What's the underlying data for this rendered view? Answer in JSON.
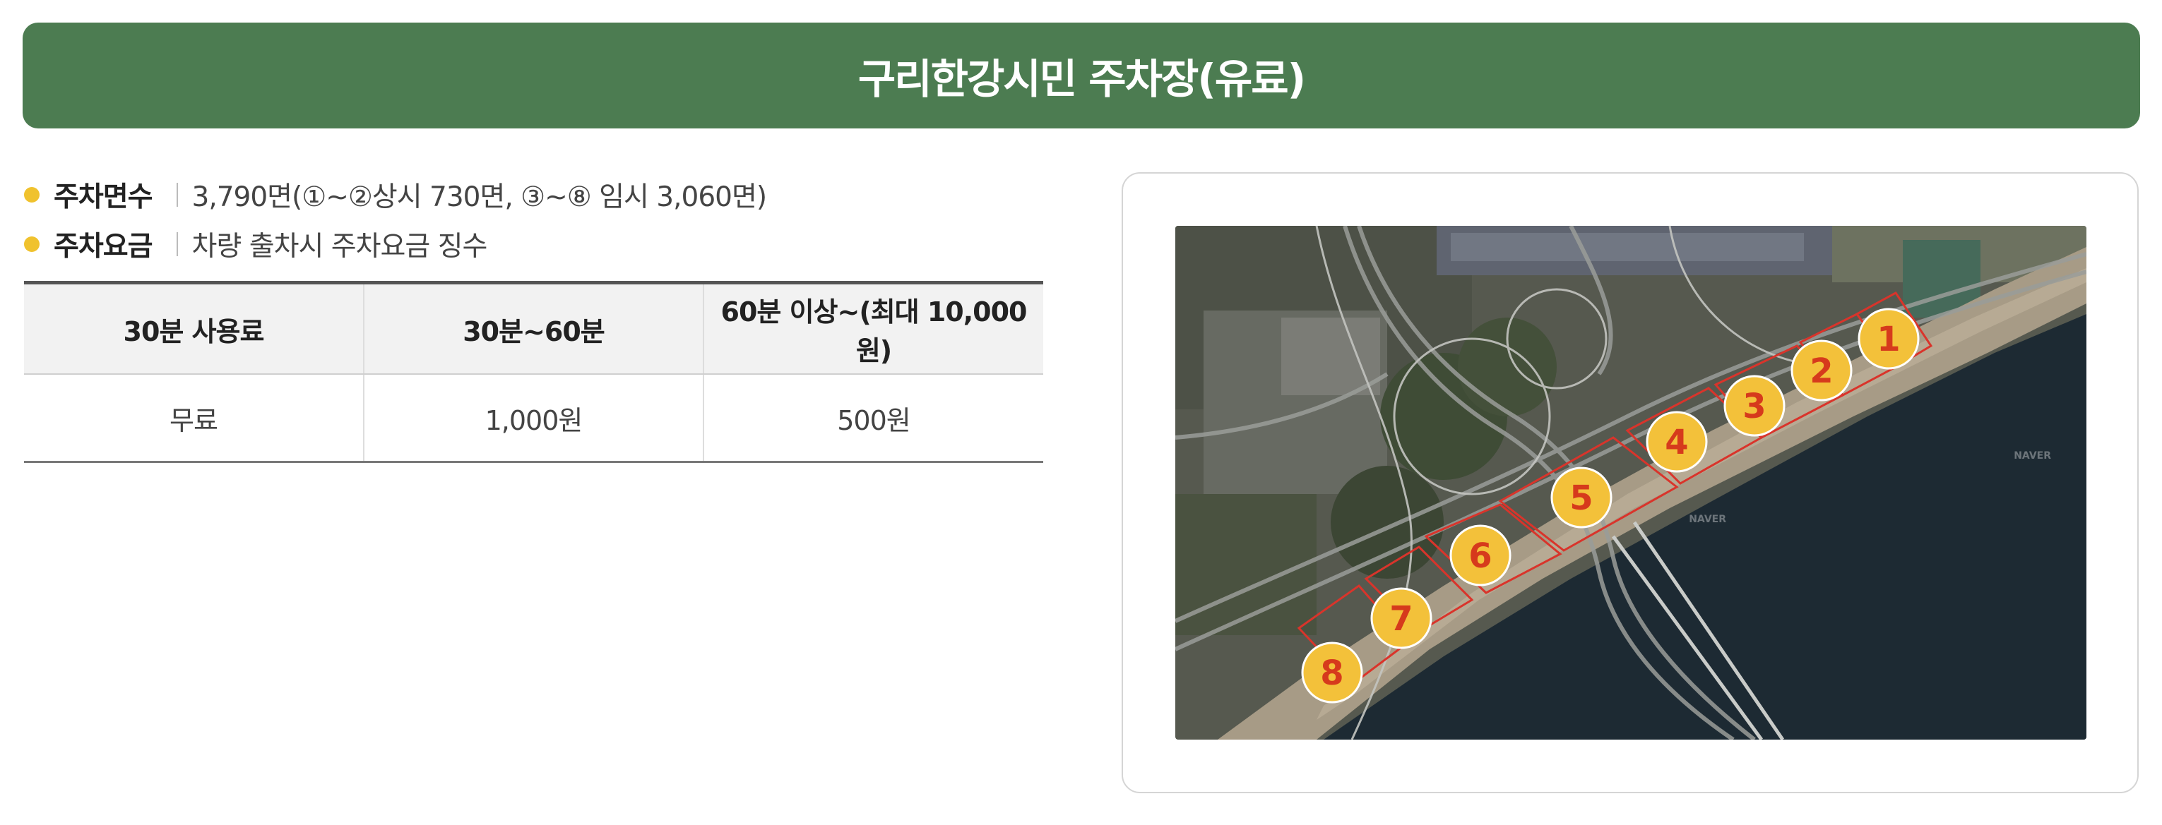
{
  "header": {
    "title": "구리한강시민 주차장(유료)"
  },
  "info": [
    {
      "label": "주차면수",
      "value": "3,790면(①~②상시 730면, ③~⑧ 임시 3,060면)"
    },
    {
      "label": "주차요금",
      "value": "차량 출차시 주차요금 징수"
    }
  ],
  "fee_table": {
    "headers": [
      "30분 사용료",
      "30분~60분",
      "60분 이상~(최대 10,000원)"
    ],
    "rows": [
      [
        "무료",
        "1,000원",
        "500원"
      ]
    ]
  },
  "map": {
    "lots": [
      "1",
      "2",
      "3",
      "4",
      "5",
      "6",
      "7",
      "8"
    ],
    "watermark": "NAVER",
    "colors": {
      "marker": "#f3c13a",
      "marker_text": "#d63a1c",
      "outline": "#d9342b",
      "river": "#1d2a33"
    }
  },
  "colors": {
    "banner": "#4c7c51",
    "bullet": "#f0c22e"
  }
}
